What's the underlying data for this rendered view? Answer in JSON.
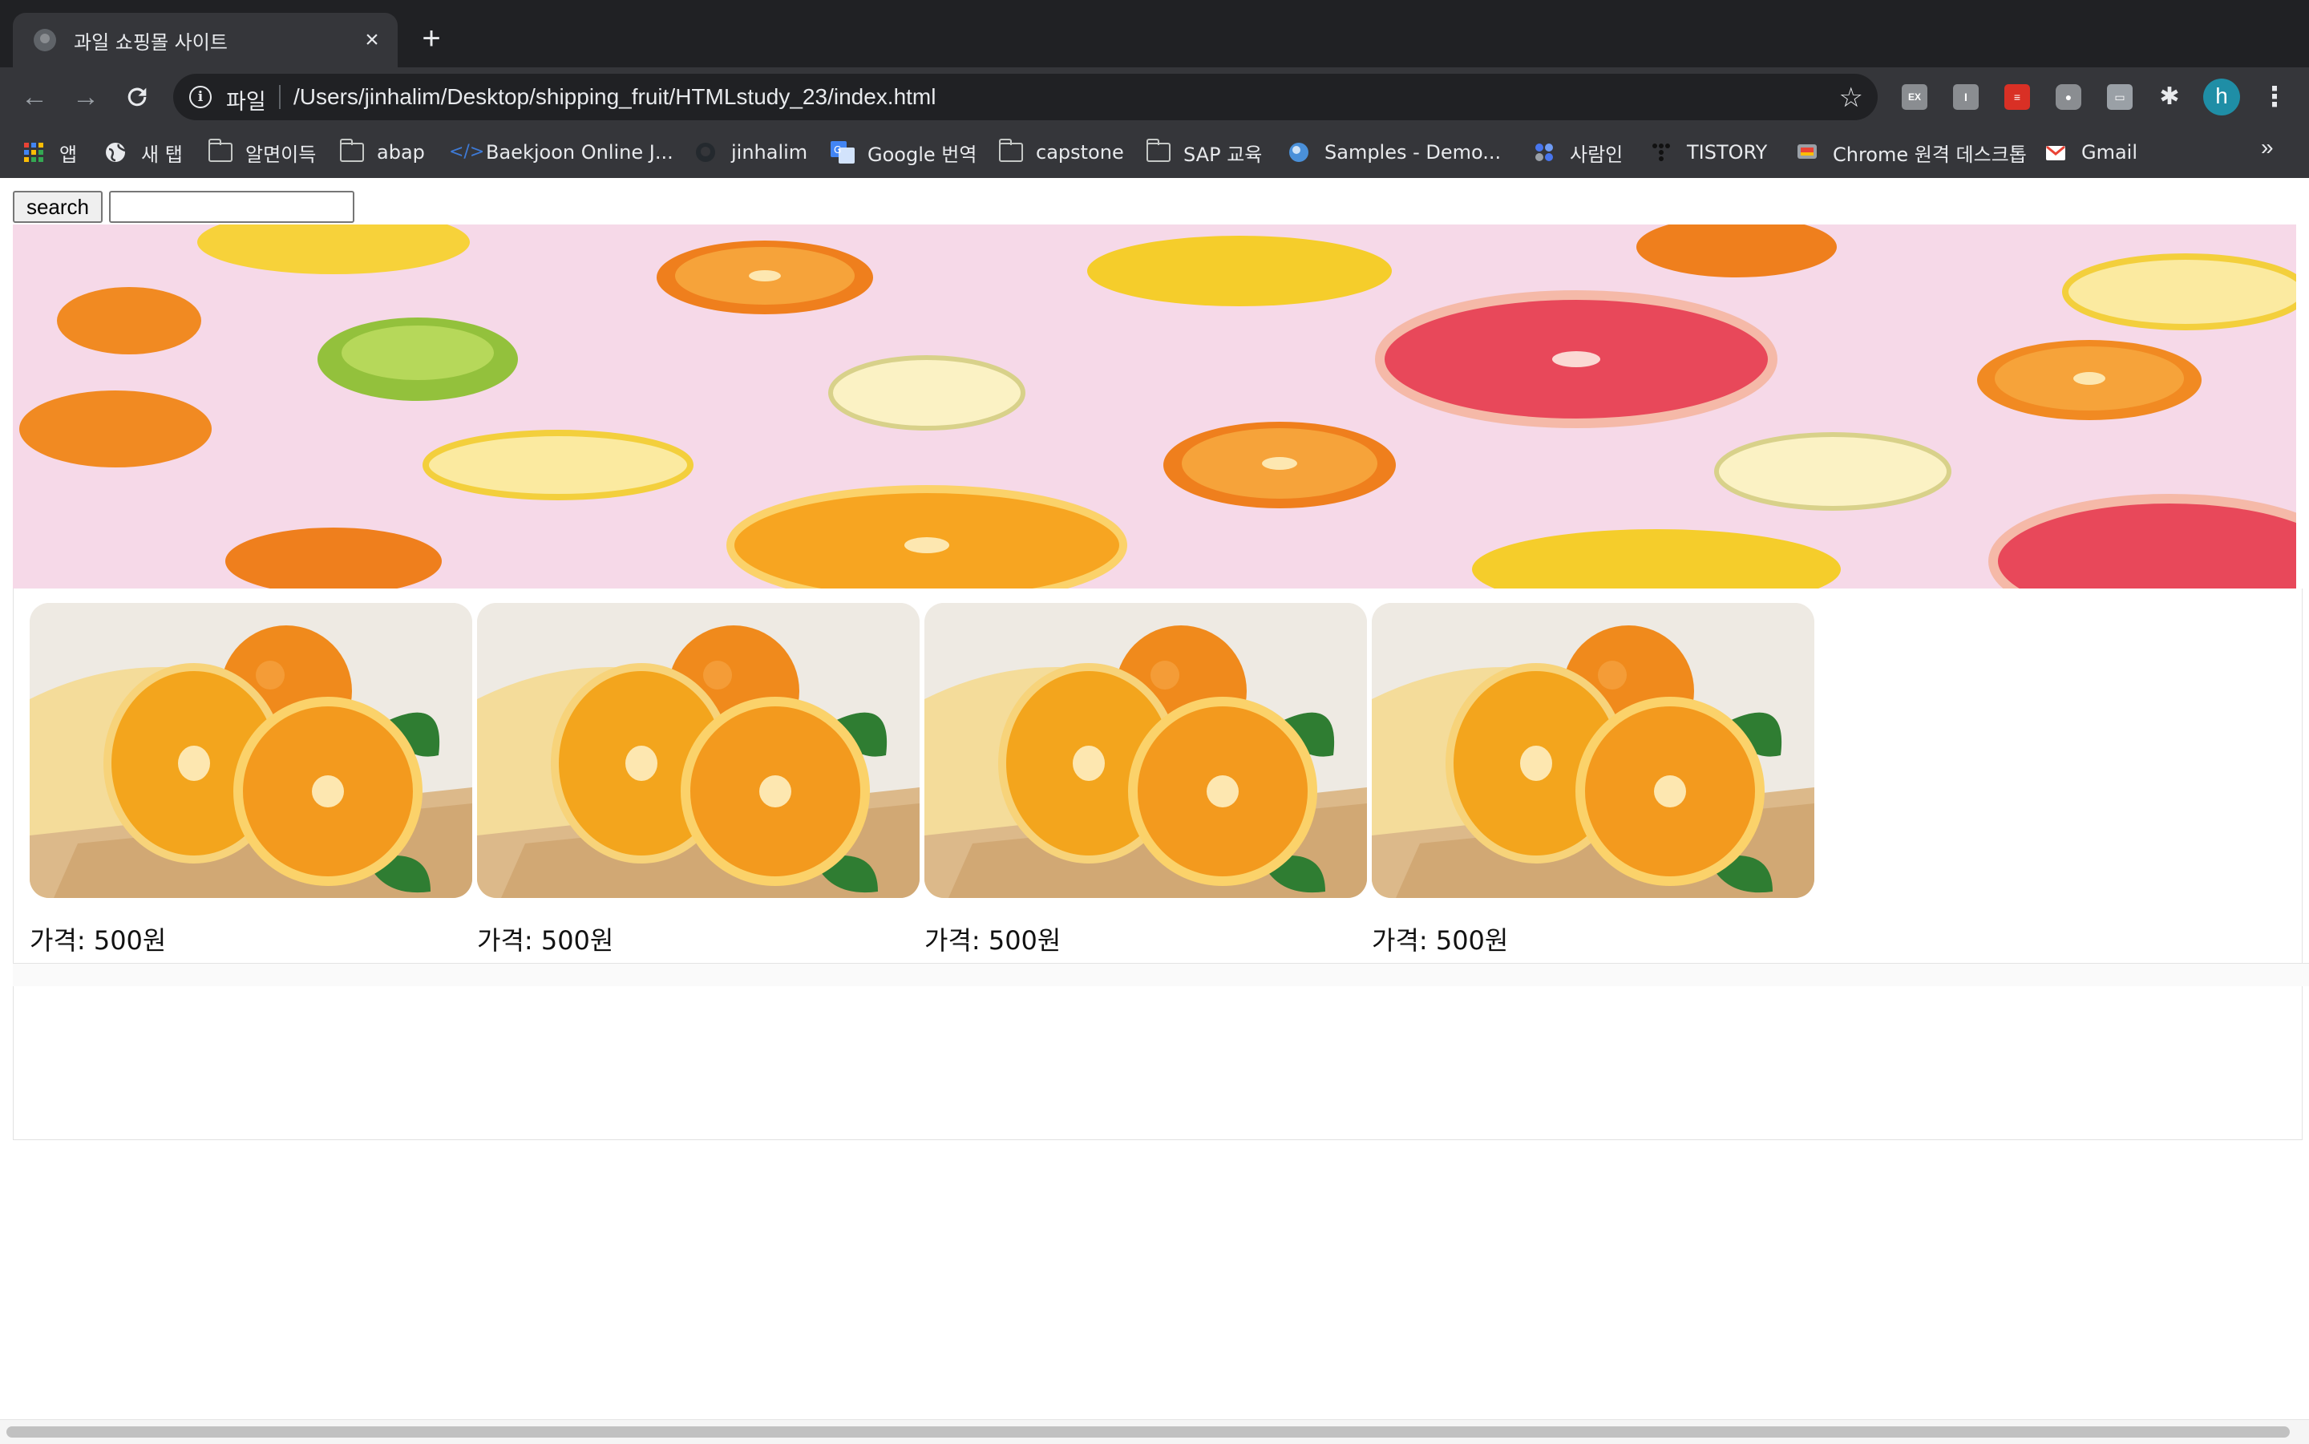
{
  "browser": {
    "tab_title": "과일 쇼핑몰 사이트",
    "omnibox": {
      "scheme_label": "파일",
      "url": "/Users/jinhalim/Desktop/shipping_fruit/HTMLstudy_23/index.html"
    },
    "avatar_initial": "h",
    "bookmarks": [
      {
        "label": "앱",
        "icon": "apps-grid-icon"
      },
      {
        "label": "새 탭",
        "icon": "globe-icon"
      },
      {
        "label": "알면이득",
        "icon": "folder-icon"
      },
      {
        "label": "abap",
        "icon": "folder-icon"
      },
      {
        "label": "Baekjoon Online J...",
        "icon": "code-icon"
      },
      {
        "label": "jinhalim",
        "icon": "github-icon"
      },
      {
        "label": "Google 번역",
        "icon": "translate-icon"
      },
      {
        "label": "capstone",
        "icon": "folder-icon"
      },
      {
        "label": "SAP 교육",
        "icon": "folder-icon"
      },
      {
        "label": "Samples - Demo...",
        "icon": "globe-icon"
      },
      {
        "label": "사람인",
        "icon": "saramin-icon"
      },
      {
        "label": "TISTORY",
        "icon": "tistory-icon"
      },
      {
        "label": "Chrome 원격 데스크톱",
        "icon": "remote-desktop-icon"
      },
      {
        "label": "Gmail",
        "icon": "gmail-icon"
      }
    ],
    "bookmarks_more": "»",
    "extensions": [
      "EX",
      "I",
      "",
      "",
      ""
    ]
  },
  "page": {
    "search_button_label": "search",
    "search_input_value": "",
    "products": [
      {
        "price_label": "가격: 500원",
        "image": "orange-product-photo"
      },
      {
        "price_label": "가격: 500원",
        "image": "orange-product-photo"
      },
      {
        "price_label": "가격: 500원",
        "image": "orange-product-photo"
      },
      {
        "price_label": "가격: 500원",
        "image": "orange-product-photo"
      }
    ]
  },
  "colors": {
    "chrome_dark": "#202124",
    "chrome_toolbar": "#35363a",
    "hero_background": "#f6d9e8",
    "orange": "#f39a1e",
    "lemon": "#f7d23a",
    "grapefruit": "#e8485a"
  }
}
